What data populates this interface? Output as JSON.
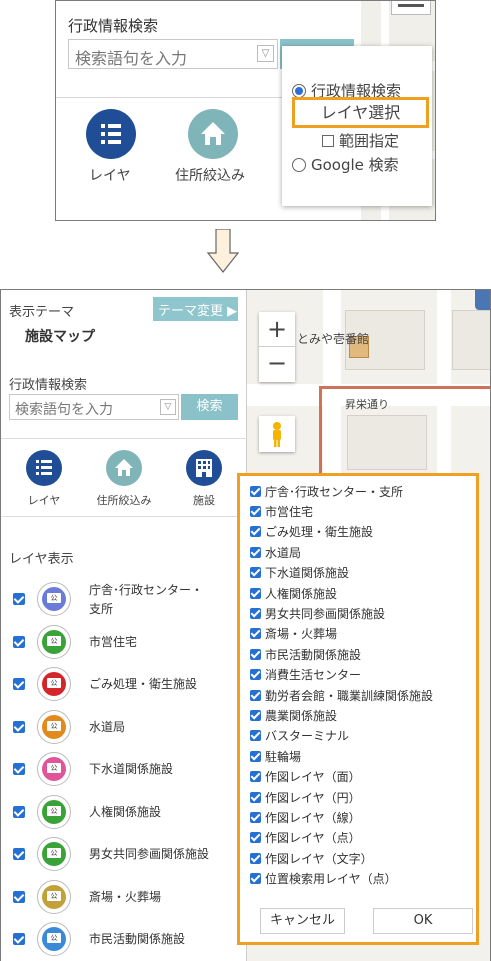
{
  "top": {
    "search_label": "行政情報検索",
    "search_placeholder": "検索語句を入力",
    "icons": [
      {
        "label": "レイヤ",
        "icon": "list-icon",
        "color": "#1f4e96"
      },
      {
        "label": "住所絞込み",
        "icon": "home-icon",
        "color": "#7fb5b9"
      }
    ],
    "popup": {
      "radio_admin": "行政情報検索",
      "layer_select": "レイヤ選択",
      "range_check": "範囲指定",
      "radio_google": "Google 検索"
    }
  },
  "sidebar": {
    "theme_title": "表示テーマ",
    "theme_button": "テーマ変更 ▶",
    "theme_name": "施設マップ",
    "search_label": "行政情報検索",
    "search_placeholder": "検索語句を入力",
    "search_button": "検索",
    "icons": [
      {
        "label": "レイヤ",
        "icon": "list-icon",
        "color": "#1f4e96"
      },
      {
        "label": "住所絞込み",
        "icon": "home-icon",
        "color": "#7fb5b9"
      },
      {
        "label": "施設",
        "icon": "building-icon",
        "color": "#1f4e96"
      }
    ],
    "layer_heading": "レイヤ表示",
    "layers": [
      {
        "name_line1": "庁舎･行政センター・",
        "name_line2": "支所",
        "color": "#6b7bd8",
        "mark": "公"
      },
      {
        "name_line1": "市営住宅",
        "name_line2": "",
        "color": "#3aa338",
        "mark": "公"
      },
      {
        "name_line1": "ごみ処理・衛生施設",
        "name_line2": "",
        "color": "#d4262a",
        "mark": "公"
      },
      {
        "name_line1": "水道局",
        "name_line2": "",
        "color": "#e28a1e",
        "mark": "公"
      },
      {
        "name_line1": "下水道関係施設",
        "name_line2": "",
        "color": "#e0559a",
        "mark": "公"
      },
      {
        "name_line1": "人権関係施設",
        "name_line2": "",
        "color": "#3aa338",
        "mark": "公"
      },
      {
        "name_line1": "男女共同参画関係施設",
        "name_line2": "",
        "color": "#3aa338",
        "mark": "公"
      },
      {
        "name_line1": "斎場・火葬場",
        "name_line2": "",
        "color": "#c2a138",
        "mark": "公"
      },
      {
        "name_line1": "市民活動関係施設",
        "name_line2": "",
        "color": "#3b8ad8",
        "mark": "公"
      }
    ]
  },
  "map": {
    "zoom_in": "+",
    "zoom_out": "−",
    "label_1": "とみや壱番館",
    "label_2": "昇栄通り"
  },
  "layer_popup": {
    "items": [
      "庁舎･行政センター・支所",
      "市営住宅",
      "ごみ処理・衛生施設",
      "水道局",
      "下水道関係施設",
      "人権関係施設",
      "男女共同参画関係施設",
      "斎場・火葬場",
      "市民活動関係施設",
      "消費生活センター",
      "勤労者会館・職業訓練関係施設",
      "農業関係施設",
      "バスターミナル",
      "駐輪場",
      "作図レイヤ（面）",
      "作図レイヤ（円）",
      "作図レイヤ（線）",
      "作図レイヤ（点）",
      "作図レイヤ（文字）",
      "位置検索用レイヤ（点）"
    ],
    "cancel": "キャンセル",
    "ok": "OK"
  },
  "colors": {
    "accent_orange": "#f0a020",
    "teal_button": "#8bc1c8",
    "navy_icon": "#1f4e96",
    "checkbox_blue": "#2670d4"
  }
}
